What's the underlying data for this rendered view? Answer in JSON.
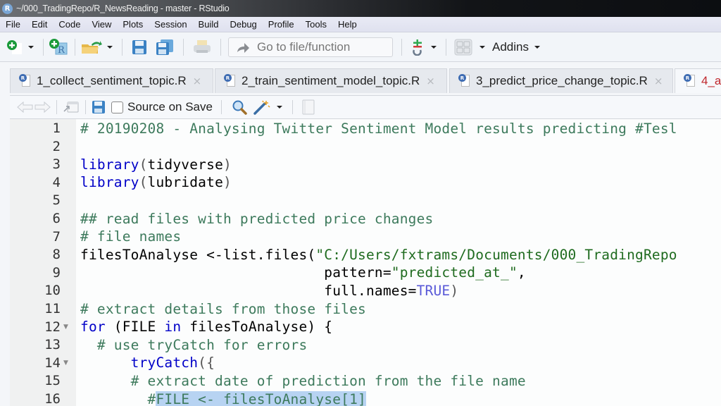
{
  "window": {
    "title": "~/000_TradingRepo/R_NewsReading - master - RStudio",
    "app_logo": "R"
  },
  "menu": [
    "File",
    "Edit",
    "Code",
    "View",
    "Plots",
    "Session",
    "Build",
    "Debug",
    "Profile",
    "Tools",
    "Help"
  ],
  "toolbar": {
    "new_file_icon": "plus-circle-icon",
    "new_project_icon": "new-r-project-icon",
    "open_icon": "folder-open-icon",
    "save_icon": "floppy-icon",
    "save_all_icon": "floppy-multiple-icon",
    "print_icon": "printer-icon",
    "goto_placeholder": "Go to file/function",
    "vcs_icon": "git-icon",
    "layout_icon": "grid-icon",
    "addins_label": "Addins"
  },
  "tabs": [
    {
      "label": "1_collect_sentiment_topic.R",
      "modified": false,
      "active": false
    },
    {
      "label": "2_train_sentiment_model_topic.R",
      "modified": false,
      "active": false
    },
    {
      "label": "3_predict_price_change_topic.R",
      "modified": false,
      "active": false
    },
    {
      "label": "4_a",
      "modified": true,
      "active": true
    }
  ],
  "tab_close_glyph": "×",
  "editor_toolbar": {
    "source_on_save_label": "Source on Save",
    "source_on_save_checked": false
  },
  "editor": {
    "lines": [
      {
        "n": "1",
        "fold": false
      },
      {
        "n": "2",
        "fold": false
      },
      {
        "n": "3",
        "fold": false
      },
      {
        "n": "4",
        "fold": false
      },
      {
        "n": "5",
        "fold": false
      },
      {
        "n": "6",
        "fold": false
      },
      {
        "n": "7",
        "fold": false
      },
      {
        "n": "8",
        "fold": false
      },
      {
        "n": "9",
        "fold": false
      },
      {
        "n": "10",
        "fold": false
      },
      {
        "n": "11",
        "fold": false
      },
      {
        "n": "12",
        "fold": true
      },
      {
        "n": "13",
        "fold": false
      },
      {
        "n": "14",
        "fold": true
      },
      {
        "n": "15",
        "fold": false
      },
      {
        "n": "16",
        "fold": false
      }
    ],
    "code": {
      "l1": "# 20190208 - Analysing Twitter Sentiment Model results predicting #Tesl",
      "l3a": "library",
      "l3b": "(",
      "l3c": "tidyverse",
      "l3d": ")",
      "l4a": "library",
      "l4b": "(",
      "l4c": "lubridate",
      "l4d": ")",
      "l6": "## read files with predicted price changes",
      "l7": "# file names",
      "l8a": "filesToAnalyse <-list.files(",
      "l8b": "\"C:/Users/fxtrams/Documents/000_TradingRepo",
      "l9a": "                             pattern=",
      "l9b": "\"predicted_at_\"",
      "l9c": ",",
      "l10a": "                             full.names=",
      "l10b": "TRUE",
      "l10c": ")",
      "l11": "# extract details from those files",
      "l12a": "for",
      "l12b": " (FILE ",
      "l12c": "in",
      "l12d": " filesToAnalyse) {",
      "l13": "  # use tryCatch for errors",
      "l14a": "      ",
      "l14b": "tryCatch",
      "l14c": "({",
      "l15": "      # extract date of prediction from the file name",
      "l16a": "        #",
      "l16b": "FILE <- filesToAnalyse[1]"
    }
  }
}
